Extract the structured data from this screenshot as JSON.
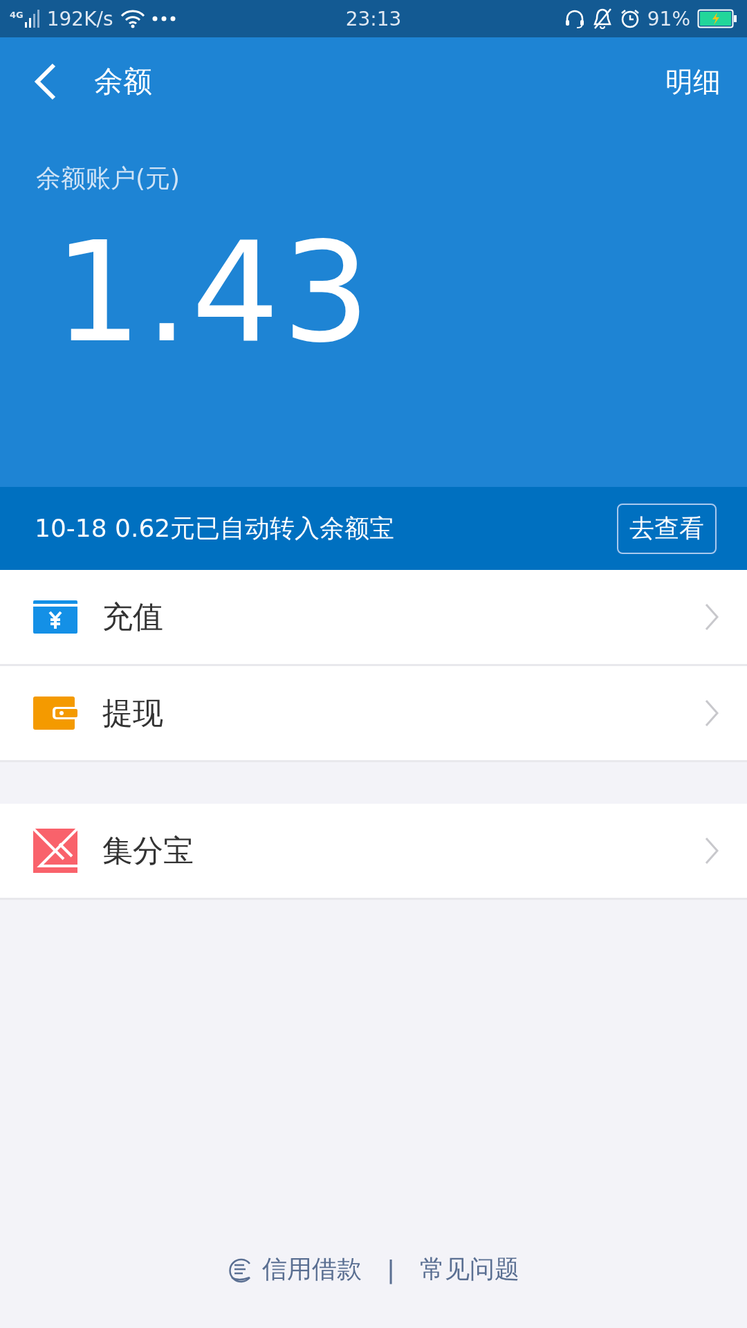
{
  "status_bar": {
    "network": "4G",
    "speed": "192K/s",
    "time": "23:13",
    "battery": "91%"
  },
  "header": {
    "title": "余额",
    "action": "明细"
  },
  "balance": {
    "label": "余额账户(元)",
    "amount": "1.43"
  },
  "notice": {
    "text": "10-18 0.62元已自动转入余额宝",
    "button": "去查看"
  },
  "menu_groups": [
    [
      {
        "kind": "recharge",
        "label": "充值"
      },
      {
        "kind": "withdraw",
        "label": "提现"
      }
    ],
    [
      {
        "kind": "points",
        "label": "集分宝"
      }
    ]
  ],
  "footer": {
    "links": [
      "信用借款",
      "常见问题"
    ],
    "separator": "|"
  }
}
